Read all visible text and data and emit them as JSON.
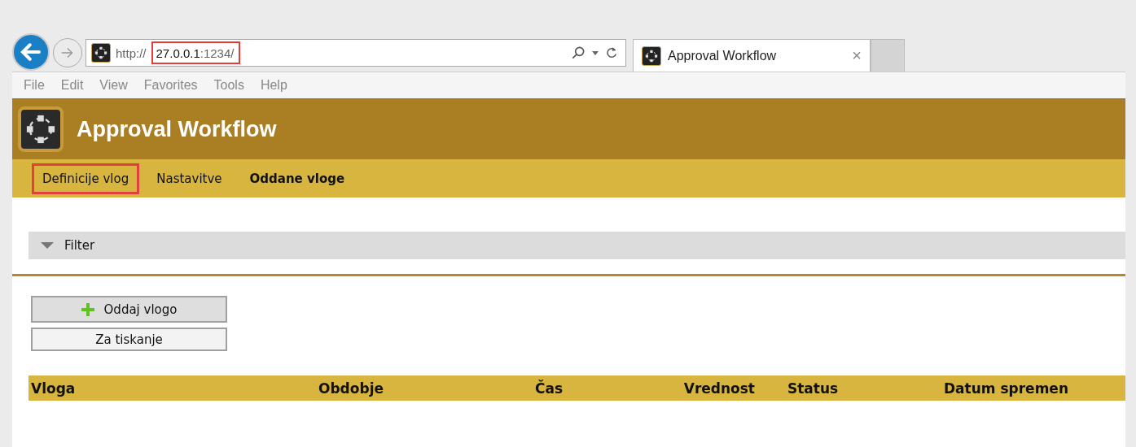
{
  "browser": {
    "address": {
      "scheme": "http://",
      "host": "27.0.0.1",
      "port": ":1234/",
      "highlighted": true
    },
    "tab": {
      "title": "Approval Workflow",
      "close": "×"
    },
    "menu": [
      "File",
      "Edit",
      "View",
      "Favorites",
      "Tools",
      "Help"
    ]
  },
  "app": {
    "title": "Approval Workflow",
    "nav": [
      {
        "label": "Definicije vlog",
        "selected": false,
        "highlighted": true
      },
      {
        "label": "Nastavitve",
        "selected": false,
        "highlighted": false
      },
      {
        "label": "Oddane vloge",
        "selected": true,
        "highlighted": false
      }
    ],
    "filter": {
      "label": "Filter",
      "expanded": false
    },
    "buttons": [
      {
        "label": "Oddaj vlogo",
        "kind": "add"
      },
      {
        "label": "Za tiskanje",
        "kind": "plain"
      }
    ],
    "table": {
      "columns": [
        "Vloga",
        "Obdobje",
        "Čas",
        "Vrednost",
        "Status",
        "Datum spremen"
      ]
    }
  }
}
